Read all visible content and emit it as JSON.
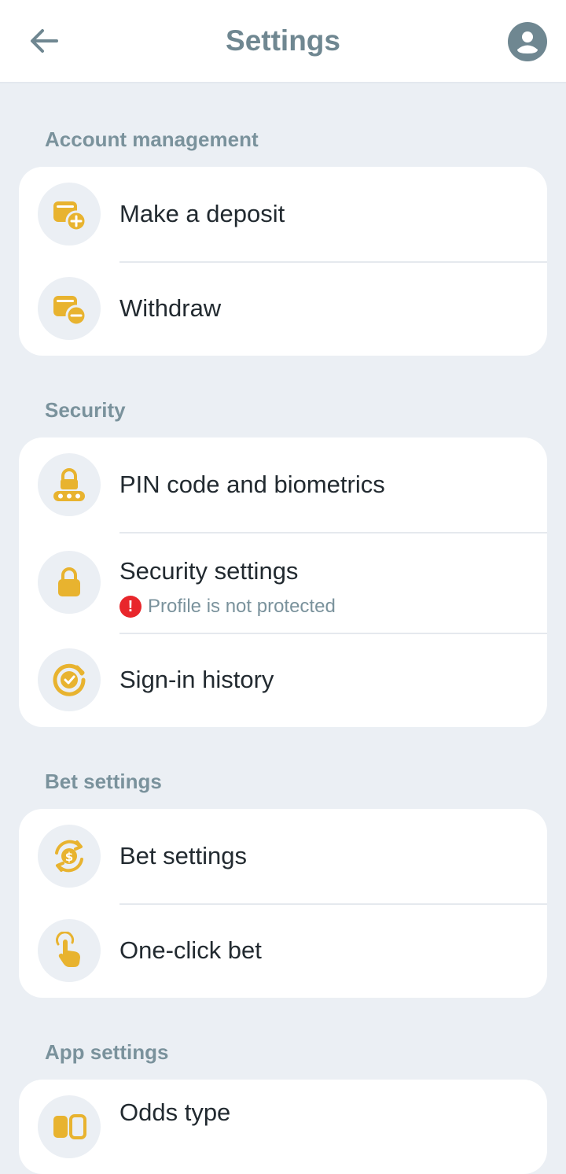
{
  "header": {
    "title": "Settings",
    "back_icon": "arrow-left-icon",
    "profile_icon": "user-avatar-icon"
  },
  "colors": {
    "accent": "#e8b32f",
    "muted_text": "#7a929c",
    "background": "#ebeff4",
    "alert": "#e8262b"
  },
  "sections": {
    "account": {
      "title": "Account management",
      "items": [
        {
          "label": "Make a deposit",
          "icon": "wallet-plus-icon"
        },
        {
          "label": "Withdraw",
          "icon": "wallet-minus-icon"
        }
      ]
    },
    "security": {
      "title": "Security",
      "items": [
        {
          "label": "PIN code and biometrics",
          "icon": "pin-lock-icon"
        },
        {
          "label": "Security settings",
          "sub": "Profile is not protected",
          "alert": "!",
          "icon": "lock-icon"
        },
        {
          "label": "Sign-in history",
          "icon": "history-check-icon"
        }
      ]
    },
    "bet": {
      "title": "Bet settings",
      "items": [
        {
          "label": "Bet settings",
          "icon": "dollar-refresh-icon"
        },
        {
          "label": "One-click bet",
          "icon": "tap-hand-icon"
        }
      ]
    },
    "app": {
      "title": "App settings",
      "items": [
        {
          "label": "Odds type",
          "icon": "odds-icon"
        }
      ]
    }
  }
}
